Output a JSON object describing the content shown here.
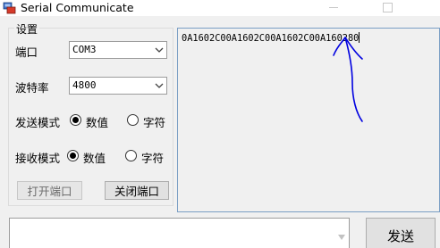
{
  "window": {
    "title": "Serial Communicate",
    "icons": {
      "app": "app-icon",
      "minimize": "minimize-icon",
      "maximize": "maximize-icon"
    }
  },
  "settings": {
    "group_title": "设置",
    "port": {
      "label": "端口",
      "value": "COM3",
      "icon": "chevron-down-icon"
    },
    "baud": {
      "label": "波特率",
      "value": "4800",
      "icon": "chevron-down-icon"
    },
    "send_mode": {
      "label": "发送模式",
      "options": [
        {
          "label": "数值",
          "checked": true
        },
        {
          "label": "字符",
          "checked": false
        }
      ]
    },
    "receive_mode": {
      "label": "接收模式",
      "options": [
        {
          "label": "数值",
          "checked": true
        },
        {
          "label": "字符",
          "checked": false
        }
      ]
    },
    "open_button": "打开端口",
    "close_button": "关闭端口"
  },
  "receive": {
    "text": "0A1602C00A1602C00A1602C00A160280"
  },
  "send": {
    "input_value": "",
    "button": "发送"
  },
  "colors": {
    "annotation": "#0000e0",
    "focus_border": "#0078d7"
  }
}
